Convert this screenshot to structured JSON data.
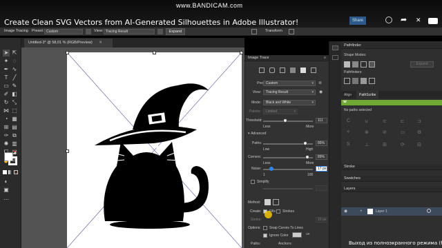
{
  "video": {
    "title": "Create Clean SVG Vectors from AI-Generated Silhouettes in Adobe Illustrator!",
    "watermark_main": "www.BANDICAM.com",
    "share_label": "Share",
    "fullscreen_message": "Выход из полноэкранного режима (f)"
  },
  "control_bar": {
    "label": "Image Tracing",
    "preset_label": "Preset:",
    "preset_value": "Custom",
    "view_label": "View:",
    "view_value": "Tracing Result",
    "expand_label": "Expand",
    "transform_label": "Transform"
  },
  "document": {
    "tab_label": "Untitled-3* @ 58,01 % (RGB/Preview)"
  },
  "image_trace": {
    "title": "Image Trace",
    "preset_label": "Preset:",
    "preset_value": "Custom",
    "view_label": "View:",
    "view_value": "Tracing Result",
    "mode_label": "Mode:",
    "mode_value": "Black and White",
    "palette_label": "Palette:",
    "palette_value": "Limited",
    "threshold_label": "Threshold:",
    "threshold_value": "111",
    "threshold_fraction": 0.44,
    "less": "Less",
    "more": "More",
    "advanced_label": "Advanced",
    "paths_label": "Paths:",
    "paths_value": "85%",
    "paths_fraction": 0.85,
    "low": "Low",
    "high": "High",
    "corners_label": "Corners:",
    "corners_value": "89%",
    "corners_fraction": 0.89,
    "noise_label": "Noise:",
    "noise_value": "17 px",
    "noise_fraction": 0.16,
    "noise_min": "1",
    "noise_max": "100",
    "method_label": "Method:",
    "create_label": "Create:",
    "fills_label": "Fills",
    "strokes_label": "Strokes",
    "stroke_label": "Stroke:",
    "stroke_value": "10 px",
    "options_label": "Options:",
    "snap_label": "Snap Curves To Lines",
    "ignore_color_label": "Ignore Color",
    "simplify_label": "Simplify",
    "paths_count_label": "Paths:",
    "anchors_label": "Anchors:"
  },
  "pathfinder": {
    "title": "Pathfinder",
    "shape_modes": "Shape Modes:",
    "pathfinders": "Pathfinders:",
    "expand": "Expand"
  },
  "pathscribe": {
    "tab_align": "Align",
    "tab_pathscribe": "PathScribe",
    "status": "No paths selected"
  },
  "side_panels": {
    "stroke": "Stroke",
    "swatches": "Swatches",
    "layers": "Layers",
    "layer_name": "Layer 1"
  },
  "colors": {
    "accent_blue": "#2f86f0",
    "pathscribe_green": "#6fa832",
    "warning_yellow": "#f2c400"
  }
}
